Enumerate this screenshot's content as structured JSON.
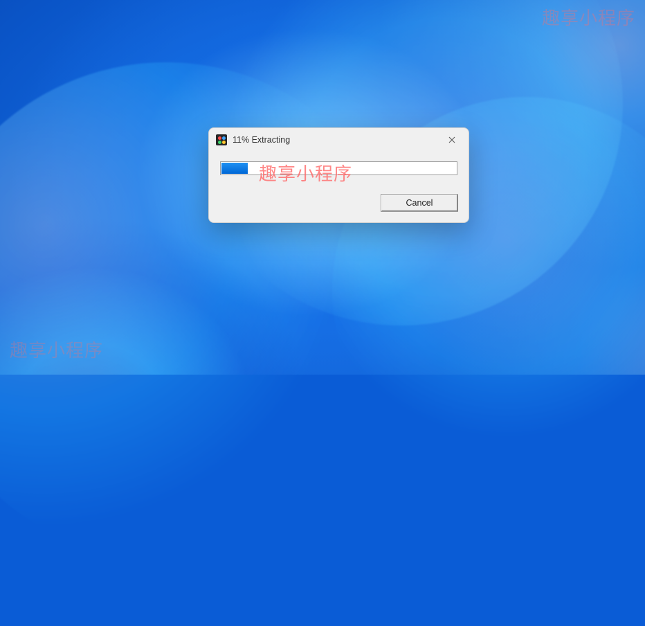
{
  "watermark": {
    "text": "趣享小程序"
  },
  "dialog": {
    "title": "11% Extracting",
    "progress_percent": 11,
    "cancel_label": "Cancel"
  },
  "colors": {
    "progress_fill": "#0a78e0",
    "dialog_bg": "#f0f0f0"
  }
}
